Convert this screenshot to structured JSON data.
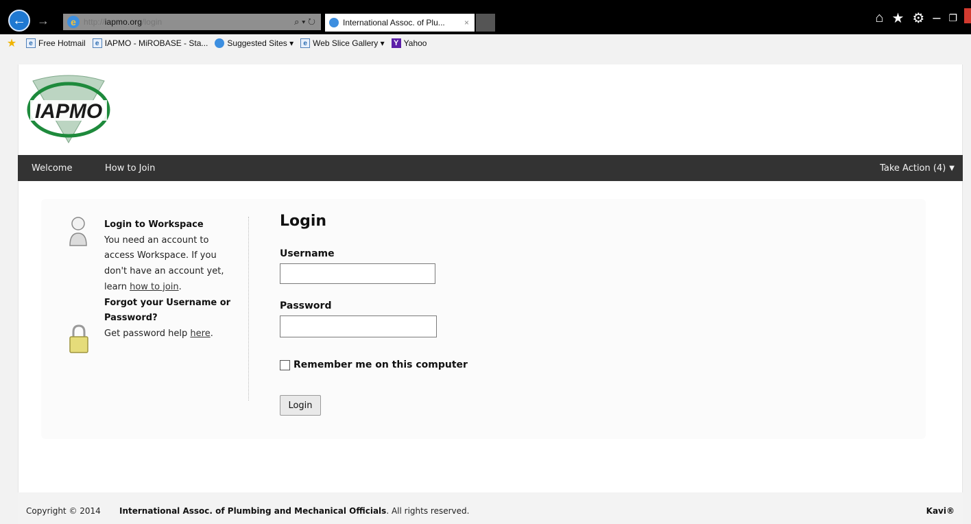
{
  "browser": {
    "url_dim_prefix": "http://",
    "url_domain": "iapmo.org",
    "url_dim_suffix": "/login",
    "address_tools": "⌕ ▾ ↻",
    "tab_title": "International Assoc. of Plu...",
    "tab_close": "×",
    "favorites": [
      {
        "label": "Free Hotmail",
        "icon": "page-icon"
      },
      {
        "label": "IAPMO - MiROBASE - Sta...",
        "icon": "page-icon"
      },
      {
        "label": "Suggested Sites ▾",
        "icon": "ie-icon"
      },
      {
        "label": "Web Slice Gallery ▾",
        "icon": "page-icon"
      },
      {
        "label": "Yahoo",
        "icon": "yahoo-icon"
      }
    ]
  },
  "logo": {
    "text": "IAPMO",
    "colors": {
      "green": "#1e8a3c",
      "dark": "#1a1a1a"
    }
  },
  "nav": {
    "welcome": "Welcome",
    "how_to_join": "How to Join",
    "take_action": "Take Action (4)",
    "caret": "▼"
  },
  "help": {
    "workspace_title": "Login to Workspace",
    "workspace_body_1": "You need an account to access Workspace. If you don't have an account yet, learn",
    "workspace_link": "how to join",
    "workspace_end": ".",
    "forgot_title": "Forgot your Username or Password?",
    "forgot_body": "Get password help",
    "forgot_link": "here",
    "forgot_end": "."
  },
  "login": {
    "title": "Login",
    "username_label": "Username",
    "username_value": "",
    "password_label": "Password",
    "password_value": "",
    "remember_label": "Remember me on this computer",
    "remember_checked": false,
    "button": "Login"
  },
  "footer": {
    "copyright": "Copyright © 2014",
    "org": "International Assoc. of Plumbing and Mechanical Officials",
    "rights": ". All rights reserved.",
    "vendor": "Kavi®"
  }
}
